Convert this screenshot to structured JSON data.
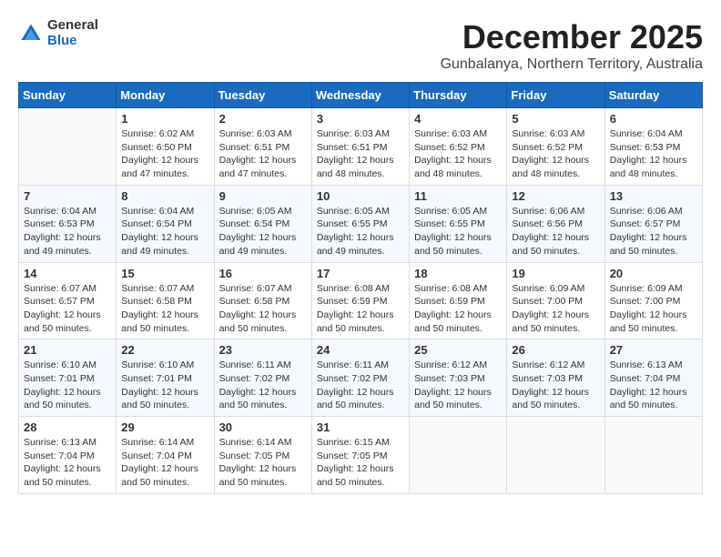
{
  "logo": {
    "general": "General",
    "blue": "Blue"
  },
  "header": {
    "month": "December 2025",
    "location": "Gunbalanya, Northern Territory, Australia"
  },
  "weekdays": [
    "Sunday",
    "Monday",
    "Tuesday",
    "Wednesday",
    "Thursday",
    "Friday",
    "Saturday"
  ],
  "weeks": [
    [
      {
        "day": "",
        "info": ""
      },
      {
        "day": "1",
        "info": "Sunrise: 6:02 AM\nSunset: 6:50 PM\nDaylight: 12 hours\nand 47 minutes."
      },
      {
        "day": "2",
        "info": "Sunrise: 6:03 AM\nSunset: 6:51 PM\nDaylight: 12 hours\nand 47 minutes."
      },
      {
        "day": "3",
        "info": "Sunrise: 6:03 AM\nSunset: 6:51 PM\nDaylight: 12 hours\nand 48 minutes."
      },
      {
        "day": "4",
        "info": "Sunrise: 6:03 AM\nSunset: 6:52 PM\nDaylight: 12 hours\nand 48 minutes."
      },
      {
        "day": "5",
        "info": "Sunrise: 6:03 AM\nSunset: 6:52 PM\nDaylight: 12 hours\nand 48 minutes."
      },
      {
        "day": "6",
        "info": "Sunrise: 6:04 AM\nSunset: 6:53 PM\nDaylight: 12 hours\nand 48 minutes."
      }
    ],
    [
      {
        "day": "7",
        "info": "Sunrise: 6:04 AM\nSunset: 6:53 PM\nDaylight: 12 hours\nand 49 minutes."
      },
      {
        "day": "8",
        "info": "Sunrise: 6:04 AM\nSunset: 6:54 PM\nDaylight: 12 hours\nand 49 minutes."
      },
      {
        "day": "9",
        "info": "Sunrise: 6:05 AM\nSunset: 6:54 PM\nDaylight: 12 hours\nand 49 minutes."
      },
      {
        "day": "10",
        "info": "Sunrise: 6:05 AM\nSunset: 6:55 PM\nDaylight: 12 hours\nand 49 minutes."
      },
      {
        "day": "11",
        "info": "Sunrise: 6:05 AM\nSunset: 6:55 PM\nDaylight: 12 hours\nand 50 minutes."
      },
      {
        "day": "12",
        "info": "Sunrise: 6:06 AM\nSunset: 6:56 PM\nDaylight: 12 hours\nand 50 minutes."
      },
      {
        "day": "13",
        "info": "Sunrise: 6:06 AM\nSunset: 6:57 PM\nDaylight: 12 hours\nand 50 minutes."
      }
    ],
    [
      {
        "day": "14",
        "info": "Sunrise: 6:07 AM\nSunset: 6:57 PM\nDaylight: 12 hours\nand 50 minutes."
      },
      {
        "day": "15",
        "info": "Sunrise: 6:07 AM\nSunset: 6:58 PM\nDaylight: 12 hours\nand 50 minutes."
      },
      {
        "day": "16",
        "info": "Sunrise: 6:07 AM\nSunset: 6:58 PM\nDaylight: 12 hours\nand 50 minutes."
      },
      {
        "day": "17",
        "info": "Sunrise: 6:08 AM\nSunset: 6:59 PM\nDaylight: 12 hours\nand 50 minutes."
      },
      {
        "day": "18",
        "info": "Sunrise: 6:08 AM\nSunset: 6:59 PM\nDaylight: 12 hours\nand 50 minutes."
      },
      {
        "day": "19",
        "info": "Sunrise: 6:09 AM\nSunset: 7:00 PM\nDaylight: 12 hours\nand 50 minutes."
      },
      {
        "day": "20",
        "info": "Sunrise: 6:09 AM\nSunset: 7:00 PM\nDaylight: 12 hours\nand 50 minutes."
      }
    ],
    [
      {
        "day": "21",
        "info": "Sunrise: 6:10 AM\nSunset: 7:01 PM\nDaylight: 12 hours\nand 50 minutes."
      },
      {
        "day": "22",
        "info": "Sunrise: 6:10 AM\nSunset: 7:01 PM\nDaylight: 12 hours\nand 50 minutes."
      },
      {
        "day": "23",
        "info": "Sunrise: 6:11 AM\nSunset: 7:02 PM\nDaylight: 12 hours\nand 50 minutes."
      },
      {
        "day": "24",
        "info": "Sunrise: 6:11 AM\nSunset: 7:02 PM\nDaylight: 12 hours\nand 50 minutes."
      },
      {
        "day": "25",
        "info": "Sunrise: 6:12 AM\nSunset: 7:03 PM\nDaylight: 12 hours\nand 50 minutes."
      },
      {
        "day": "26",
        "info": "Sunrise: 6:12 AM\nSunset: 7:03 PM\nDaylight: 12 hours\nand 50 minutes."
      },
      {
        "day": "27",
        "info": "Sunrise: 6:13 AM\nSunset: 7:04 PM\nDaylight: 12 hours\nand 50 minutes."
      }
    ],
    [
      {
        "day": "28",
        "info": "Sunrise: 6:13 AM\nSunset: 7:04 PM\nDaylight: 12 hours\nand 50 minutes."
      },
      {
        "day": "29",
        "info": "Sunrise: 6:14 AM\nSunset: 7:04 PM\nDaylight: 12 hours\nand 50 minutes."
      },
      {
        "day": "30",
        "info": "Sunrise: 6:14 AM\nSunset: 7:05 PM\nDaylight: 12 hours\nand 50 minutes."
      },
      {
        "day": "31",
        "info": "Sunrise: 6:15 AM\nSunset: 7:05 PM\nDaylight: 12 hours\nand 50 minutes."
      },
      {
        "day": "",
        "info": ""
      },
      {
        "day": "",
        "info": ""
      },
      {
        "day": "",
        "info": ""
      }
    ]
  ]
}
